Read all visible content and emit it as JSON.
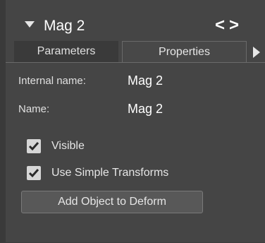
{
  "header": {
    "title": "Mag 2",
    "nav": "<>"
  },
  "tabs": [
    {
      "label": "Parameters",
      "active": false
    },
    {
      "label": "Properties",
      "active": true
    }
  ],
  "properties": {
    "internal_name_label": "Internal name:",
    "internal_name_value": "Mag 2",
    "name_label": "Name:",
    "name_value": "Mag 2"
  },
  "options": {
    "visible_label": "Visible",
    "visible_checked": true,
    "simple_transforms_label": "Use Simple Transforms",
    "simple_transforms_checked": true
  },
  "actions": {
    "add_object_label": "Add Object to Deform"
  },
  "colors": {
    "background": "#454545",
    "tab_inactive": "#3a3a3a",
    "text": "#e6e6e6",
    "checkbox": "#d7d7d7"
  },
  "icons": {
    "collapse": "triangle-down-icon",
    "nav": "prev-next-icon",
    "tab_scroll": "triangle-right-icon",
    "check": "checkmark-icon"
  }
}
